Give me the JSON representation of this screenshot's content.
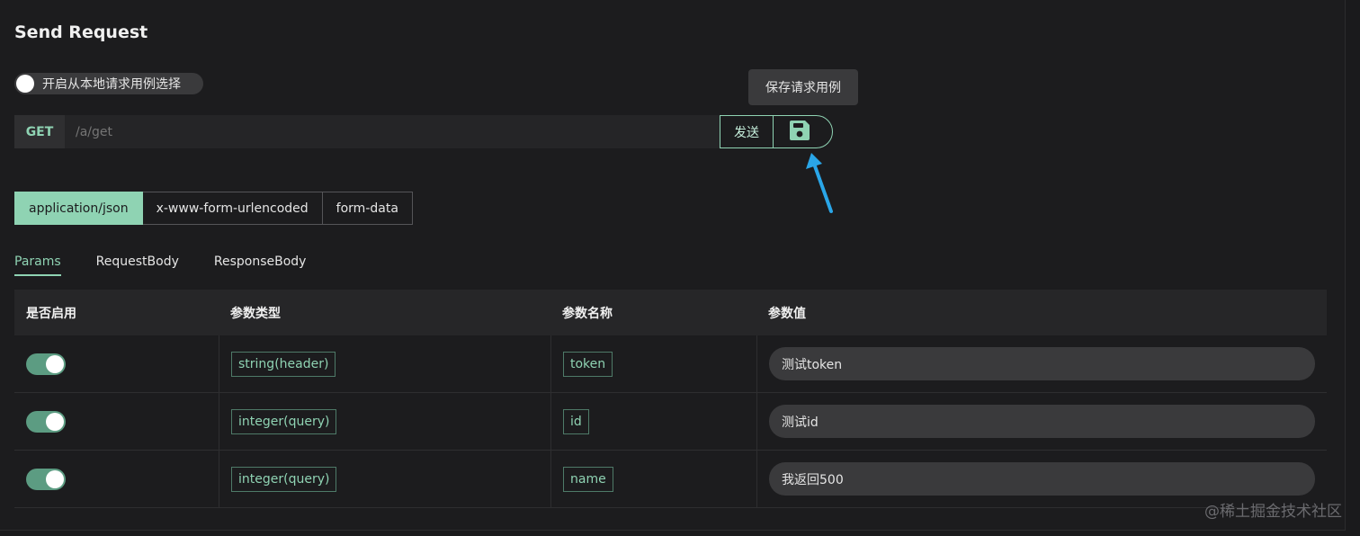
{
  "title": "Send Request",
  "local_toggle": {
    "label": "开启从本地请求用例选择",
    "on": false
  },
  "tooltip": "保存请求用例",
  "request": {
    "method": "GET",
    "url": "/a/get",
    "send_label": "发送",
    "save_icon": "floppy-disk-icon"
  },
  "content_types": [
    {
      "label": "application/json",
      "active": true
    },
    {
      "label": "x-www-form-urlencoded",
      "active": false
    },
    {
      "label": "form-data",
      "active": false
    }
  ],
  "tabs": [
    {
      "label": "Params",
      "active": true
    },
    {
      "label": "RequestBody",
      "active": false
    },
    {
      "label": "ResponseBody",
      "active": false
    }
  ],
  "table": {
    "headers": [
      "是否启用",
      "参数类型",
      "参数名称",
      "参数值"
    ],
    "rows": [
      {
        "enabled": true,
        "type": "string(header)",
        "name": "token",
        "value": "测试token"
      },
      {
        "enabled": true,
        "type": "integer(query)",
        "name": "id",
        "value": "测试id"
      },
      {
        "enabled": true,
        "type": "integer(query)",
        "name": "name",
        "value": "我返回500"
      }
    ]
  },
  "watermark": "@稀土掘金技术社区",
  "colors": {
    "accent": "#8fd3b3",
    "switch_on": "#5c9c82",
    "background": "#1c1c1e",
    "arrow": "#2aa6e8"
  }
}
